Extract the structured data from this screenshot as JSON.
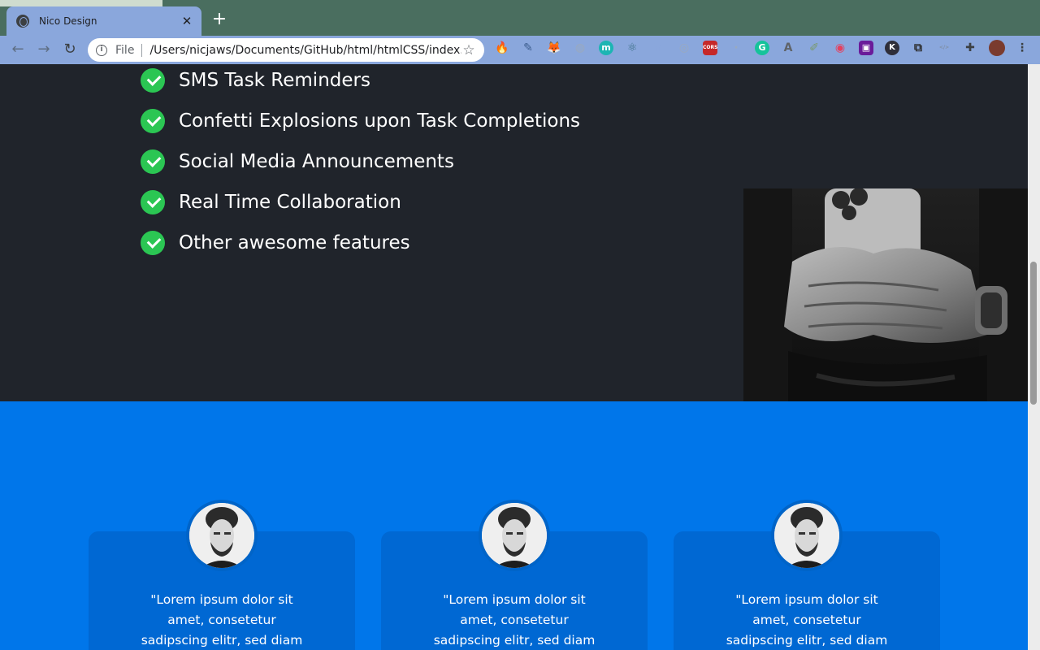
{
  "browser": {
    "tab_title": "Nico Design",
    "tab_close": "✕",
    "new_tab": "+",
    "back": "←",
    "forward": "→",
    "reload": "↻",
    "scheme_label": "File",
    "url": "/Users/nicjaws/Documents/GitHub/html/htmlCSS/index....",
    "star": "☆",
    "extensions": [
      {
        "name": "flame-extension-icon",
        "glyph": "🔥",
        "color": "#e8622c"
      },
      {
        "name": "eyedropper-extension-icon",
        "glyph": "✎",
        "color": "#3b5b8c"
      },
      {
        "name": "fox-extension-icon",
        "glyph": "🦊",
        "color": "#e2761b"
      },
      {
        "name": "circle-extension-icon",
        "glyph": "◍",
        "color": "#9aa9be"
      },
      {
        "name": "m-extension-icon",
        "glyph": "m",
        "color": "#1cb5b3"
      },
      {
        "name": "react-extension-icon",
        "glyph": "⚛",
        "color": "#3b6f83"
      },
      {
        "name": "y-extension-icon",
        "glyph": "Y",
        "color": "#8aa7dc"
      },
      {
        "name": "target-extension-icon",
        "glyph": "◎",
        "color": "#9aa9be"
      },
      {
        "name": "cors-extension-icon",
        "glyph": "CORS",
        "color": "#c62828"
      },
      {
        "name": "faded-extension-icon",
        "glyph": "·",
        "color": "#9aa9be"
      },
      {
        "name": "grammarly-extension-icon",
        "glyph": "G",
        "color": "#15c39a"
      },
      {
        "name": "a-extension-icon",
        "glyph": "A",
        "color": "#5f6368"
      },
      {
        "name": "pen-extension-icon",
        "glyph": "✐",
        "color": "#7a9a6a"
      },
      {
        "name": "record-extension-icon",
        "glyph": "◉",
        "color": "#e4405f"
      },
      {
        "name": "square-extension-icon",
        "glyph": "▣",
        "color": "#6a1b9a"
      },
      {
        "name": "k-extension-icon",
        "glyph": "K",
        "color": "#2e2e3a"
      },
      {
        "name": "link-extension-icon",
        "glyph": "⧉",
        "color": "#2b2b2b"
      },
      {
        "name": "code-extension-icon",
        "glyph": "</>",
        "color": "#7f8fa6"
      },
      {
        "name": "puzzle-extension-icon",
        "glyph": "✚",
        "color": "#3c4043"
      },
      {
        "name": "profile-avatar",
        "glyph": "",
        "color": "#7a3b2e"
      },
      {
        "name": "menu-icon",
        "glyph": "⋮",
        "color": "#3c4043"
      }
    ]
  },
  "features": [
    "SMS Task Reminders",
    "Confetti Explosions upon Task Completions",
    "Social Media Announcements",
    "Real Time Collaboration",
    "Other awesome features"
  ],
  "testimonials": [
    {
      "quote": "\"Lorem ipsum dolor sit amet, consetetur sadipscing elitr, sed diam"
    },
    {
      "quote": "\"Lorem ipsum dolor sit amet, consetetur sadipscing elitr, sed diam"
    },
    {
      "quote": "\"Lorem ipsum dolor sit amet, consetetur sadipscing elitr, sed diam"
    }
  ],
  "colors": {
    "dark_section": "#20242b",
    "blue_section": "#0076ea",
    "card": "#0068d3",
    "check": "#2bc653"
  }
}
